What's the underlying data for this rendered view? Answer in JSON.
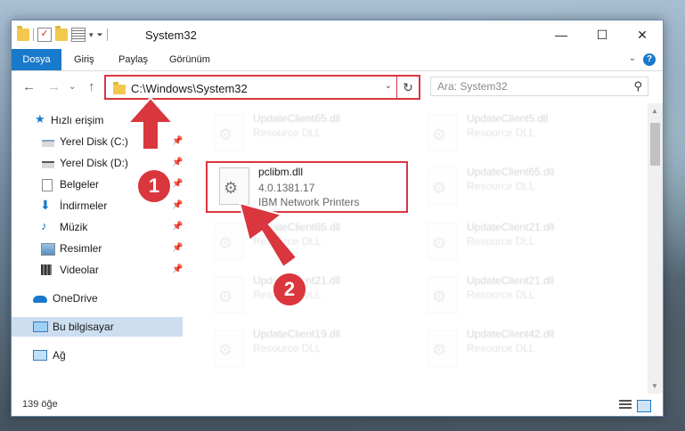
{
  "window": {
    "title": "System32",
    "controls": {
      "minimize": "—",
      "maximize": "☐",
      "close": "✕"
    }
  },
  "ribbon": {
    "tabs": [
      "Dosya",
      "Giriş",
      "Paylaş",
      "Görünüm"
    ],
    "help": "?"
  },
  "navbar": {
    "address": "C:\\Windows\\System32",
    "search_placeholder": "Ara: System32"
  },
  "sidebar": {
    "items": [
      {
        "label": "Hızlı erişim",
        "icon": "star-icon"
      },
      {
        "label": "Yerel Disk (C:)",
        "icon": "drive-icon",
        "pinned": true
      },
      {
        "label": "Yerel Disk (D:)",
        "icon": "drive-icon",
        "pinned": true
      },
      {
        "label": "Belgeler",
        "icon": "documents-icon",
        "pinned": true
      },
      {
        "label": "İndirmeler",
        "icon": "download-icon",
        "pinned": true
      },
      {
        "label": "Müzik",
        "icon": "music-icon",
        "pinned": true
      },
      {
        "label": "Resimler",
        "icon": "pictures-icon",
        "pinned": true
      },
      {
        "label": "Videolar",
        "icon": "videos-icon",
        "pinned": true
      },
      {
        "label": "OneDrive",
        "icon": "cloud-icon"
      },
      {
        "label": "Bu bilgisayar",
        "icon": "computer-icon",
        "selected": true
      },
      {
        "label": "Ağ",
        "icon": "network-icon"
      }
    ]
  },
  "files": {
    "highlighted": {
      "name": "pclibm.dll",
      "version": "4.0.1381.17",
      "description": "IBM Network Printers"
    },
    "background": [
      {
        "name": "UpdateClient65.dll",
        "type": "Resource DLL"
      },
      {
        "name": "UpdateClient5.dll",
        "type": "Resource DLL"
      },
      {
        "name": "UpdateClient65.dll",
        "type": "Resource DLL"
      },
      {
        "name": "UpdateClient65.dll",
        "type": "Resource DLL"
      },
      {
        "name": "UpdateClient21.dll",
        "type": "Resource DLL"
      },
      {
        "name": "UpdateClient21.dll",
        "type": "Resource DLL"
      },
      {
        "name": "UpdateClient21.dll",
        "type": "Resource DLL"
      },
      {
        "name": "UpdateClient19.dll",
        "type": "Resource DLL"
      },
      {
        "name": "UpdateClient42.dll",
        "type": "Resource DLL"
      }
    ]
  },
  "status": {
    "count": "139 öğe"
  },
  "annotations": {
    "step1": "1",
    "step2": "2"
  },
  "colors": {
    "accent": "#1979ca",
    "highlight": "#d9363e",
    "selected": "#ccdef0"
  }
}
